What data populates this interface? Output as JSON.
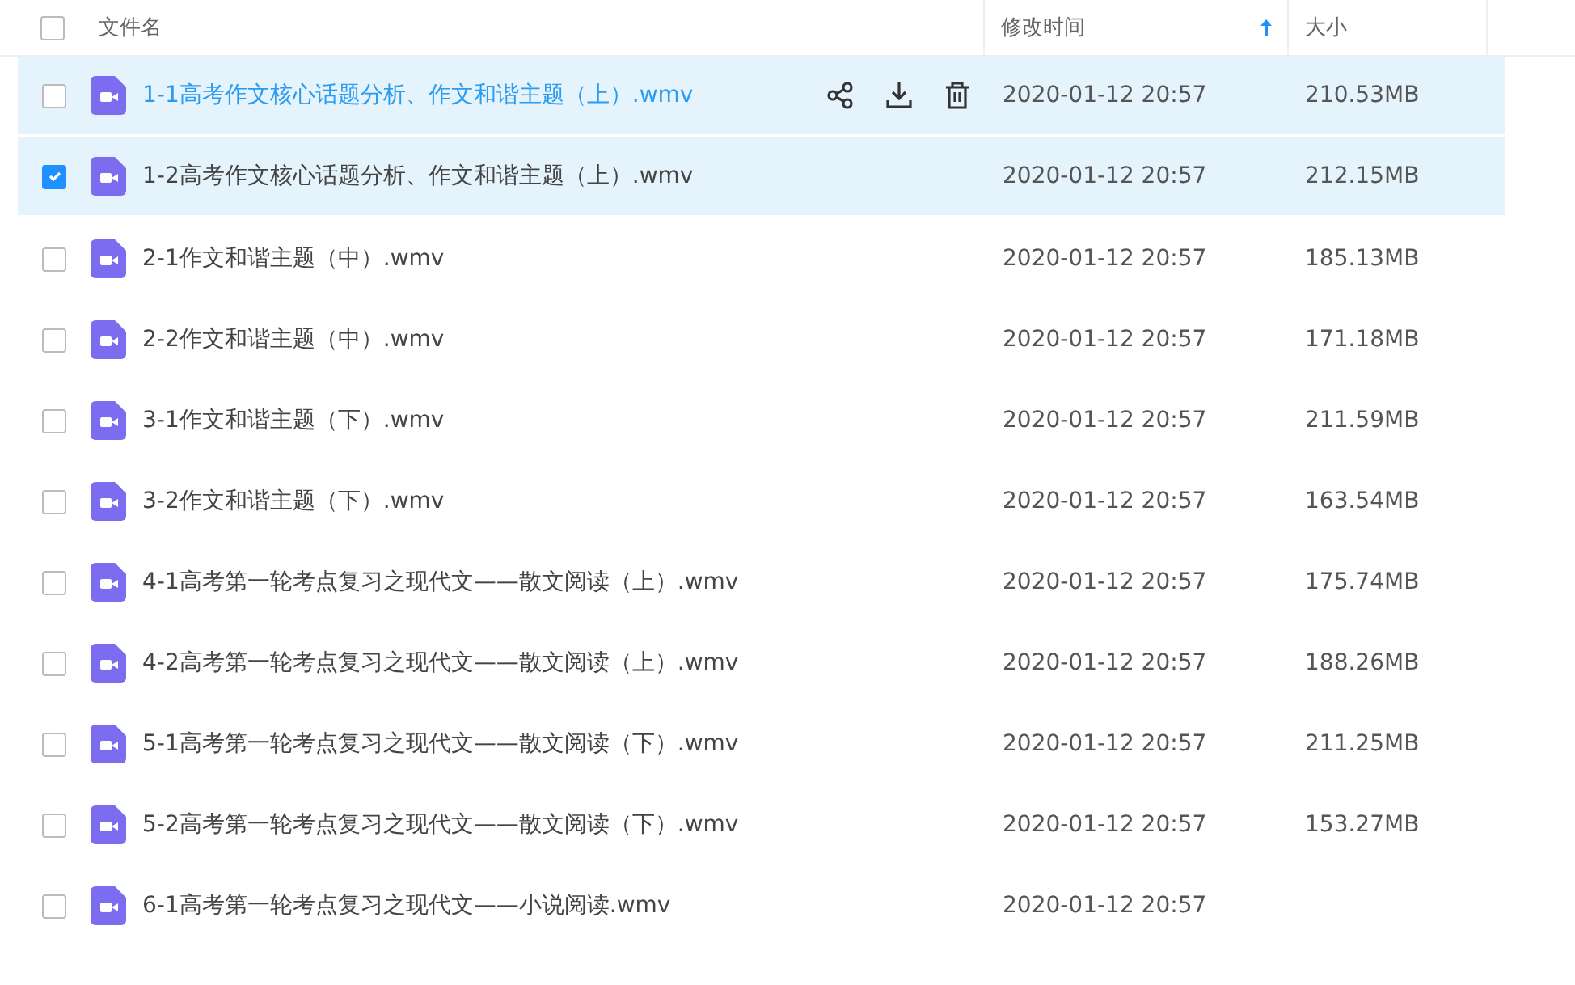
{
  "header": {
    "all_checked": false,
    "columns": [
      {
        "label": "文件名",
        "sorted": false
      },
      {
        "label": "修改时间",
        "sorted": true
      },
      {
        "label": "大小",
        "sorted": false
      }
    ]
  },
  "rows": [
    {
      "name": "1-1高考作文核心话题分析、作文和谐主题（上）.wmv",
      "modified": "2020-01-12 20:57",
      "size": "210.53MB",
      "checked": false,
      "hovered": true
    },
    {
      "name": "1-2高考作文核心话题分析、作文和谐主题（上）.wmv",
      "modified": "2020-01-12 20:57",
      "size": "212.15MB",
      "checked": true,
      "hovered": false
    },
    {
      "name": "2-1作文和谐主题（中）.wmv",
      "modified": "2020-01-12 20:57",
      "size": "185.13MB",
      "checked": false,
      "hovered": false
    },
    {
      "name": "2-2作文和谐主题（中）.wmv",
      "modified": "2020-01-12 20:57",
      "size": "171.18MB",
      "checked": false,
      "hovered": false
    },
    {
      "name": "3-1作文和谐主题（下）.wmv",
      "modified": "2020-01-12 20:57",
      "size": "211.59MB",
      "checked": false,
      "hovered": false
    },
    {
      "name": "3-2作文和谐主题（下）.wmv",
      "modified": "2020-01-12 20:57",
      "size": "163.54MB",
      "checked": false,
      "hovered": false
    },
    {
      "name": "4-1高考第一轮考点复习之现代文——散文阅读（上）.wmv",
      "modified": "2020-01-12 20:57",
      "size": "175.74MB",
      "checked": false,
      "hovered": false
    },
    {
      "name": "4-2高考第一轮考点复习之现代文——散文阅读（上）.wmv",
      "modified": "2020-01-12 20:57",
      "size": "188.26MB",
      "checked": false,
      "hovered": false
    },
    {
      "name": "5-1高考第一轮考点复习之现代文——散文阅读（下）.wmv",
      "modified": "2020-01-12 20:57",
      "size": "211.25MB",
      "checked": false,
      "hovered": false
    },
    {
      "name": "5-2高考第一轮考点复习之现代文——散文阅读（下）.wmv",
      "modified": "2020-01-12 20:57",
      "size": "153.27MB",
      "checked": false,
      "hovered": false
    },
    {
      "name": "6-1高考第一轮考点复习之现代文——小说阅读.wmv",
      "modified": "2020-01-12 20:57",
      "checked": false,
      "hovered": false
    }
  ]
}
